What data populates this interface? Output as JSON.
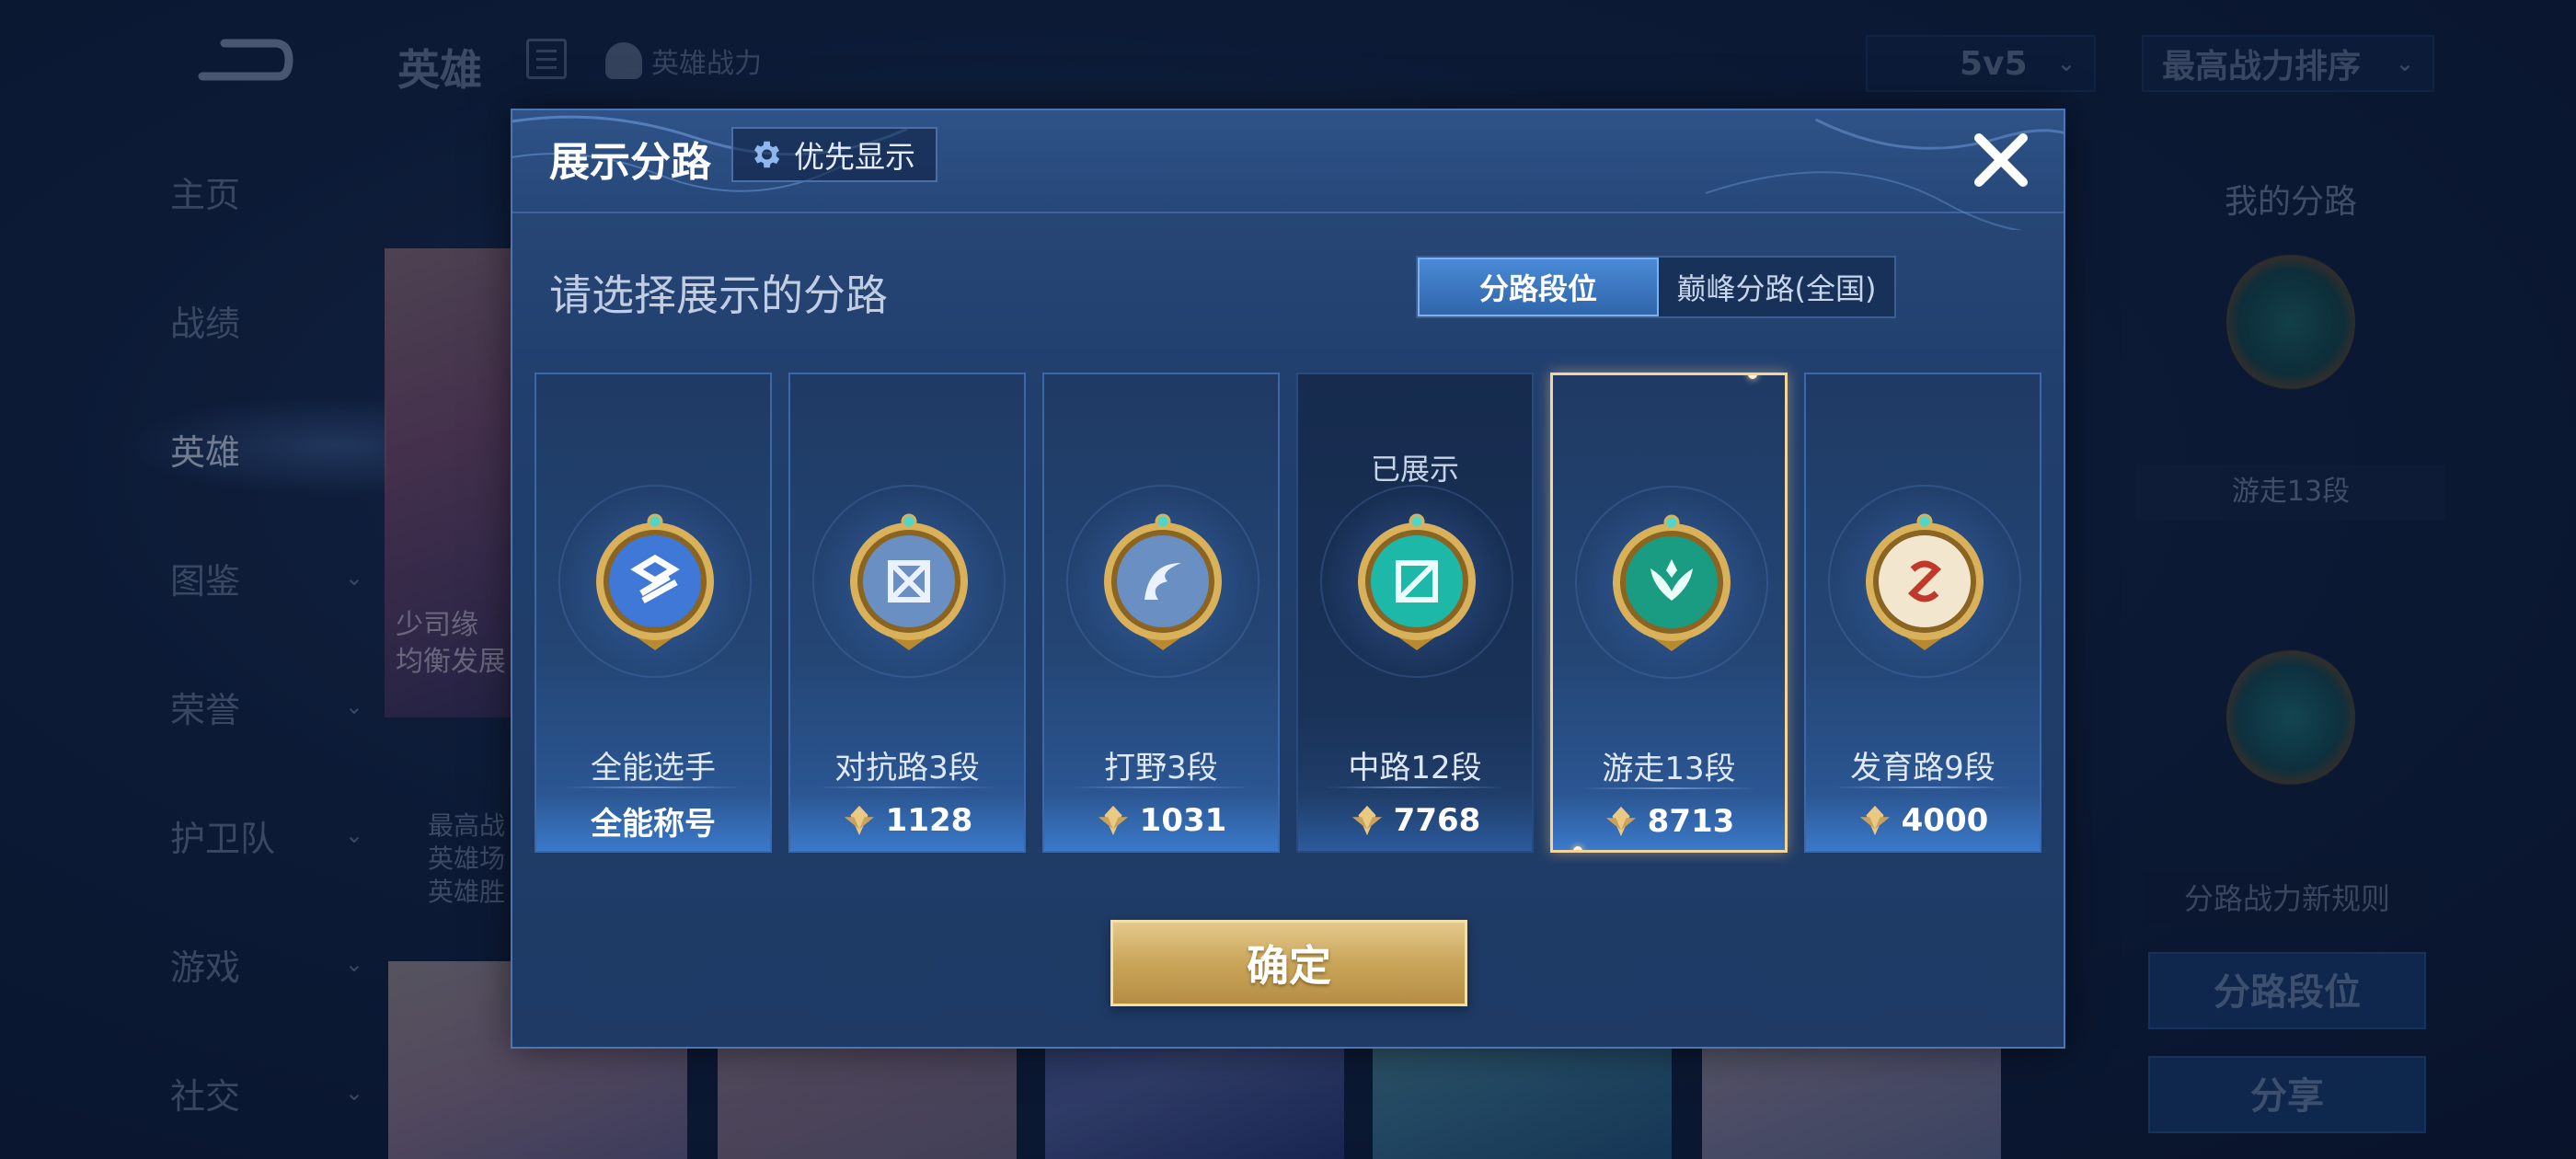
{
  "topbar": {
    "title": "英雄",
    "power_tab": "英雄战力",
    "mode_select": "5v5",
    "sort_select": "最高战力排序"
  },
  "nav": {
    "items": [
      {
        "label": "主页",
        "has_chevron": false
      },
      {
        "label": "战绩",
        "has_chevron": false
      },
      {
        "label": "英雄",
        "has_chevron": false,
        "active": true
      },
      {
        "label": "图鉴",
        "has_chevron": true
      },
      {
        "label": "荣誉",
        "has_chevron": true
      },
      {
        "label": "护卫队",
        "has_chevron": true
      },
      {
        "label": "游戏",
        "has_chevron": true
      },
      {
        "label": "社交",
        "has_chevron": true
      }
    ]
  },
  "hero": {
    "tag_line1": "少司缘",
    "tag_line2": "均衡发展",
    "stat_line1": "最高战",
    "stat_line2": "英雄场",
    "stat_line3": "英雄胜"
  },
  "right_panel": {
    "title": "我的分路",
    "lane_label": "游走13段",
    "rule_text": "分路战力新规则",
    "lane_rank_button": "分路段位",
    "share_button": "分享"
  },
  "modal": {
    "title": "展示分路",
    "priority_button": "优先显示",
    "subtitle": "请选择展示的分路",
    "tabs": {
      "active": "分路段位",
      "inactive": "巅峰分路(全国)"
    },
    "confirm_button": "确定",
    "shown_label": "已展示",
    "lanes": [
      {
        "name": "全能选手",
        "value": "全能称号",
        "has_icon": false,
        "color": "#3f78d6"
      },
      {
        "name": "对抗路3段",
        "value": "1128",
        "has_icon": true,
        "color": "#6a8fc2"
      },
      {
        "name": "打野3段",
        "value": "1031",
        "has_icon": true,
        "color": "#6a8fc2"
      },
      {
        "name": "中路12段",
        "value": "7768",
        "has_icon": true,
        "color": "#1db8a8",
        "shown": true
      },
      {
        "name": "游走13段",
        "value": "8713",
        "has_icon": true,
        "color": "#1a9c82",
        "selected": true
      },
      {
        "name": "发育路9段",
        "value": "4000",
        "has_icon": true,
        "color": "#d89a3a"
      }
    ]
  },
  "colors": {
    "accent_blue": "#3f78d6",
    "gold": "#c9a55a",
    "selected_border": "#f3d59a"
  }
}
